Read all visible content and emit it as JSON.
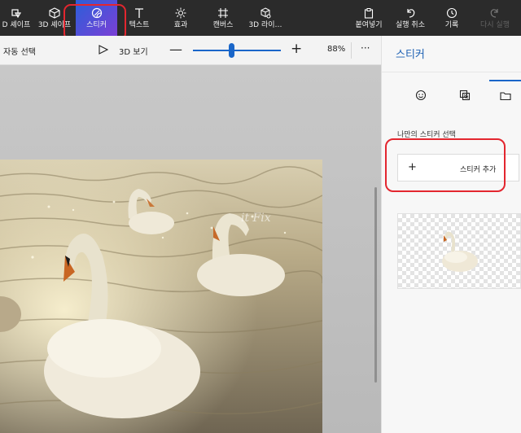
{
  "toolbar": {
    "items": [
      {
        "label": "D 셰이프",
        "icon": "3d-shapes-icon"
      },
      {
        "label": "3D 셰이프",
        "icon": "cube-icon"
      },
      {
        "label": "스티커",
        "icon": "sticker-icon",
        "active": true
      },
      {
        "label": "텍스트",
        "icon": "text-icon"
      },
      {
        "label": "효과",
        "icon": "sun-icon"
      },
      {
        "label": "캔버스",
        "icon": "canvas-icon"
      },
      {
        "label": "3D 라이…",
        "icon": "3d-library-icon"
      }
    ],
    "right_items": [
      {
        "label": "붙여넣기",
        "icon": "paste-icon"
      },
      {
        "label": "실행 취소",
        "icon": "undo-icon"
      },
      {
        "label": "기록",
        "icon": "history-icon"
      },
      {
        "label": "다시 실행",
        "icon": "redo-icon",
        "disabled": true
      }
    ]
  },
  "subbar": {
    "auto_select": "자동 선택",
    "view_3d": "3D 보기",
    "zoom_minus": "—",
    "zoom_plus": "+",
    "zoom_level": "88%",
    "more": "···",
    "zoom_slider_fraction": 0.45
  },
  "canvas": {
    "watermark": "it Fix"
  },
  "panel": {
    "title": "스티커",
    "tabs": [
      {
        "icon": "smiley-sticker-icon"
      },
      {
        "icon": "texture-icon"
      },
      {
        "icon": "folder-icon",
        "active": true
      }
    ],
    "section_label": "나만의 스티커 선택",
    "add_button_plus": "+",
    "add_button_label": "스티커 추가"
  },
  "colors": {
    "toolbar_bg": "#2b2b2b",
    "accent": "#1a66c9",
    "highlight": "#e3262f"
  }
}
